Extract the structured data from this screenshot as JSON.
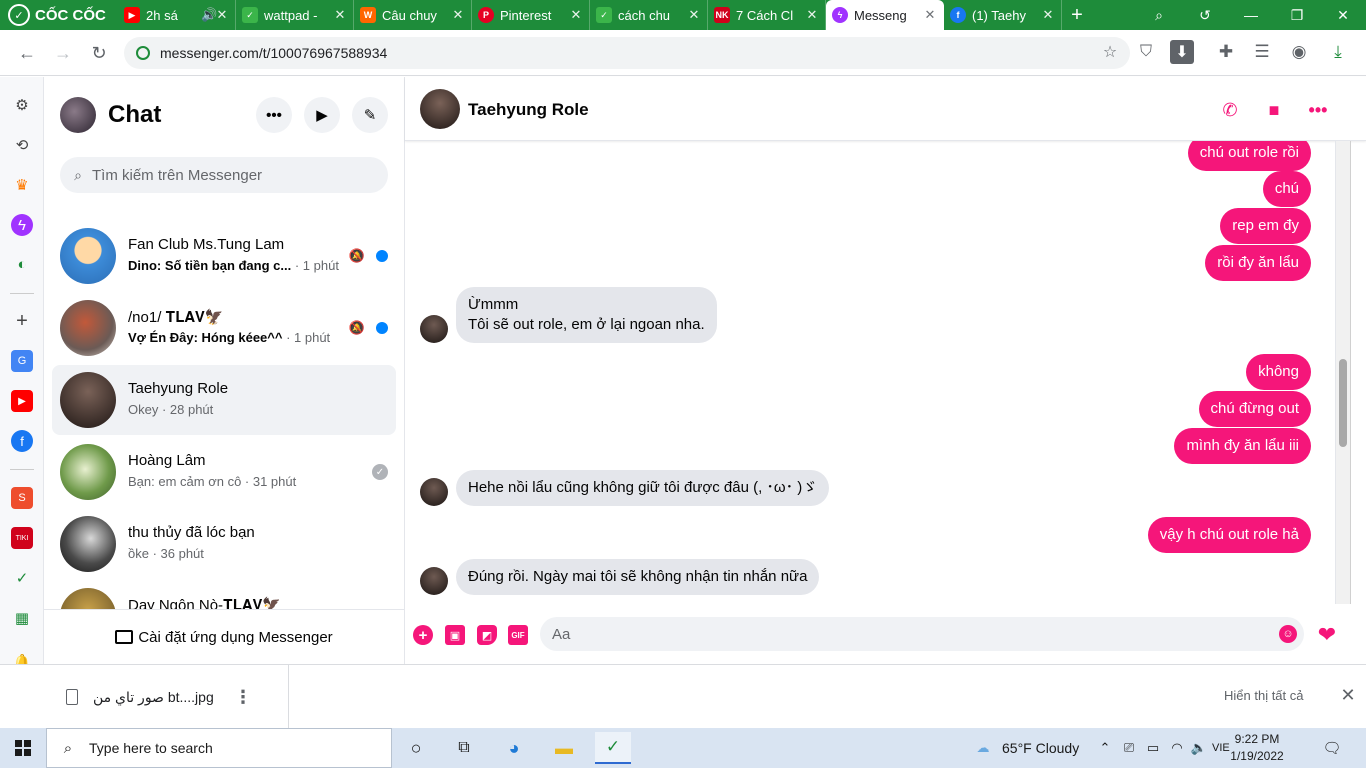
{
  "browser": {
    "brand": "CỐC CỐC",
    "tabs": [
      {
        "label": "2h sá",
        "color": "#ff0000",
        "icon": "youtube-icon"
      },
      {
        "label": "wattpad -",
        "color": "#3bb54a",
        "icon": "coccoc-icon"
      },
      {
        "label": "Câu chuy",
        "color": "#ff6600",
        "icon": "wattpad-icon"
      },
      {
        "label": "Pinterest",
        "color": "#e60023",
        "icon": "pinterest-icon"
      },
      {
        "label": "cách chu",
        "color": "#3bb54a",
        "icon": "coccoc-icon"
      },
      {
        "label": "7 Cách Cl",
        "color": "#d0021b",
        "icon": "nk-icon"
      },
      {
        "label": "Messeng",
        "color": "#a033ff",
        "icon": "messenger-icon"
      },
      {
        "label": "(1) Taehy",
        "color": "#1877f2",
        "icon": "facebook-icon"
      }
    ],
    "url": "messenger.com/t/100076967588934"
  },
  "messenger": {
    "title": "Chat",
    "search_placeholder": "Tìm kiếm trên Messenger",
    "install_label": "Cài đặt ứng dụng Messenger",
    "conversations": [
      {
        "name": "Fan Club Ms.Tung Lam",
        "preview": "Dino: Số tiền bạn đang c...",
        "time": " · 1 phút",
        "unread": true,
        "muted": true
      },
      {
        "name": "/no1/ 𝐓𝐋𝐀𝐕🦅",
        "preview": "Vợ Én Đây: Hóng kéee^^",
        "time": " · 1 phút",
        "unread": true,
        "muted": true
      },
      {
        "name": "Taehyung Role",
        "preview": "Okey",
        "time": " · 28 phút",
        "selected": true
      },
      {
        "name": "Hoàng Lâm",
        "preview": "Bạn: em cảm ơn cô",
        "time": " · 31 phút",
        "seen": true
      },
      {
        "name": "thu thủy đã lóc bạn",
        "preview": "ồke",
        "time": " · 36 phút"
      },
      {
        "name": "Dạy Ngôn Nò-𝐓𝐋𝐀𝐕🦅",
        "preview": "",
        "time": ""
      }
    ]
  },
  "chat": {
    "contact_name": "Taehyung Role",
    "composer_placeholder": "Aa",
    "messages": [
      {
        "dir": "out",
        "text": "chú out role rồi"
      },
      {
        "dir": "out",
        "text": "chú"
      },
      {
        "dir": "out",
        "text": "rep em đy"
      },
      {
        "dir": "out",
        "text": "rồi đy ăn lẩu"
      },
      {
        "dir": "in",
        "line1": "Ừmmm",
        "line2": "Tôi sẽ out role, em ở lại ngoan nha."
      },
      {
        "dir": "out",
        "text": "không"
      },
      {
        "dir": "out",
        "text": "chú đừng out"
      },
      {
        "dir": "out",
        "text": "mình đy ăn lẩu iii"
      },
      {
        "dir": "in",
        "text": "Hehe nồi lẩu cũng không giữ tôi được đâu (, ･ω･ )ゞ"
      },
      {
        "dir": "out",
        "text": "vậy h chú out role hả"
      },
      {
        "dir": "in",
        "text": "Đúng rồi. Ngày mai tôi sẽ không nhận tin nhắn nữa"
      }
    ],
    "accent_color": "#f5167a"
  },
  "downloads": {
    "file_name": "صور تاي من bt....jpg",
    "show_all": "Hiển thị tất cả"
  },
  "taskbar": {
    "search_placeholder": "Type here to search",
    "weather": "65°F  Cloudy",
    "language": "VIE",
    "time": "9:22 PM",
    "date": "1/19/2022"
  }
}
